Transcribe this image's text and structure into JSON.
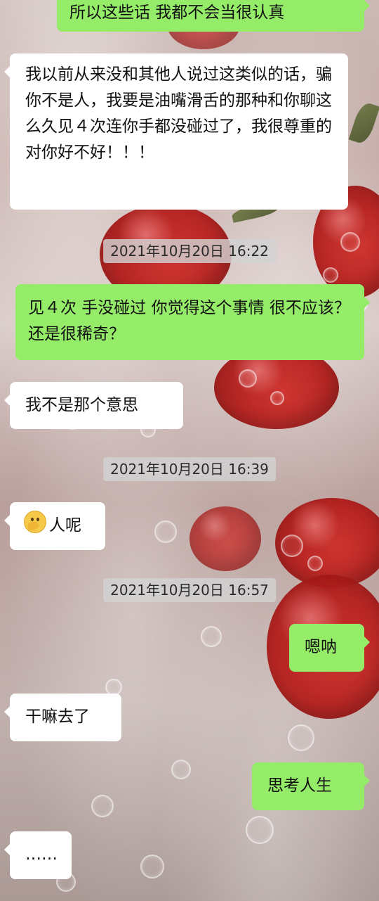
{
  "chat": {
    "top_partial": "所以这些话 我都不会当很认真",
    "messages": [
      {
        "id": "m1",
        "type": "received",
        "text": "我以前从来没和其他人说过这类似的话，骗你不是人，我要是油嘴滑舌的那种和你聊这么久见４次连你手都没碰过了，我很尊重的对你好不好！！！"
      },
      {
        "id": "t1",
        "type": "timestamp",
        "text": "2021年10月20日 16:22"
      },
      {
        "id": "m2",
        "type": "sent",
        "text": "见４次 手没碰过 你觉得这个事情 很不应该？ 还是很稀奇？"
      },
      {
        "id": "m3",
        "type": "received",
        "text": "我不是那个意思"
      },
      {
        "id": "t2",
        "type": "timestamp",
        "text": "2021年10月20日 16:39"
      },
      {
        "id": "m4",
        "type": "received",
        "text": "人呢",
        "emoji": "facepalm-emoji"
      },
      {
        "id": "t3",
        "type": "timestamp",
        "text": "2021年10月20日 16:57"
      },
      {
        "id": "m5",
        "type": "sent",
        "text": "嗯呐"
      },
      {
        "id": "m6",
        "type": "received",
        "text": "干嘛去了"
      },
      {
        "id": "m7",
        "type": "sent",
        "text": "思考人生"
      },
      {
        "id": "m8",
        "type": "received",
        "text": "……"
      }
    ]
  },
  "colors": {
    "sent_bubble": "#95ec69",
    "received_bubble": "#ffffff",
    "timestamp_bg": "#d2d2d2"
  }
}
